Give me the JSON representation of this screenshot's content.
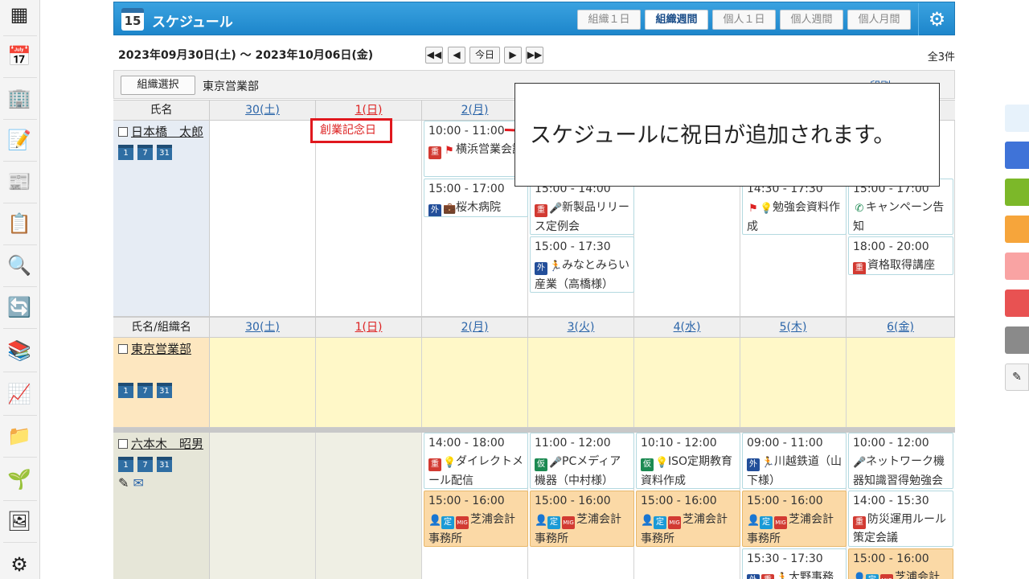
{
  "app": {
    "title": "スケジュール",
    "calendar_day": "15",
    "view_buttons": [
      "組織１日",
      "組織週間",
      "個人１日",
      "個人週間",
      "個人月間"
    ],
    "active_view": "組織週間"
  },
  "toolbar": {
    "date_range": "2023年09月30日(土) 〜 2023年10月06日(金)",
    "today": "今日",
    "count": "全3件",
    "org_select": "組織選択",
    "org_name": "東京営業部",
    "print": "印刷"
  },
  "headers": {
    "top": {
      "name": "氏名",
      "days": [
        "30(土)",
        "1(日)",
        "2(月)"
      ]
    },
    "second": {
      "name": "氏名/組織名",
      "days": [
        "30(土)",
        "1(日)",
        "2(月)",
        "3(火)",
        "4(水)",
        "5(木)",
        "6(金)"
      ]
    }
  },
  "holiday_label": "創業記念日",
  "callout_text": "スケジュールに祝日が追加されます。",
  "rows": {
    "user1": {
      "name": "日本橋　太郎",
      "events": {
        "e1": {
          "time": "10:00 - 11:00",
          "title": "横浜営業会議",
          "tag": "重"
        },
        "e2": {
          "time": "15:00 - 17:00",
          "title": "桜木病院",
          "tag": "外"
        },
        "e3": {
          "time": "15:00 - 14:00",
          "title": "新製品リリース定例会",
          "tag": "重"
        },
        "e4": {
          "time": "15:00 - 17:30",
          "title": "みなとみらい産業（高橋様）",
          "tag": "外"
        },
        "e5": {
          "time": "14:30 - 17:30",
          "title": "勉強会資料作成"
        },
        "e6": {
          "time": "15:00 - 17:00",
          "title": "キャンペーン告知"
        },
        "e7": {
          "time": "18:00 - 20:00",
          "title": "資格取得講座",
          "tag": "重"
        }
      }
    },
    "org": {
      "name": "東京営業部"
    },
    "user2": {
      "name": "六本木　昭男",
      "events": {
        "a1": {
          "time": "14:00 - 18:00",
          "title": "ダイレクトメール配信",
          "tag": "重"
        },
        "a2": {
          "time": "15:00 - 16:00",
          "title": "芝浦会計事務所",
          "tag": "定"
        },
        "b1": {
          "time": "11:00 - 12:00",
          "title": "PCメディア機器（中村様）",
          "tag": "仮"
        },
        "b2": {
          "time": "15:00 - 16:00",
          "title": "芝浦会計事務所",
          "tag": "定"
        },
        "c1": {
          "time": "10:10 - 12:00",
          "title": "ISO定期教育資料作成",
          "tag": "仮"
        },
        "c2": {
          "time": "15:00 - 16:00",
          "title": "芝浦会計事務所",
          "tag": "定"
        },
        "d1": {
          "time": "09:00 - 11:00",
          "title": "川越鉄道（山下様）",
          "tag": "外"
        },
        "d2": {
          "time": "15:00 - 16:00",
          "title": "芝浦会計事務所",
          "tag": "定"
        },
        "d3": {
          "time": "15:30 - 17:30",
          "title": "大野事務",
          "tag": "外"
        },
        "f1": {
          "time": "10:00 - 12:00",
          "title": "ネットワーク機器知識習得勉強会"
        },
        "f2": {
          "time": "14:00 - 15:30",
          "title": "防災運用ルール策定会議",
          "tag": "重"
        },
        "f3": {
          "time": "15:00 - 16:00",
          "title": "芝浦会計",
          "tag": "定"
        }
      }
    }
  },
  "tags": {
    "juu": "重",
    "gai": "外",
    "kari": "仮",
    "tei": "定",
    "mig": "MIG"
  },
  "colors": {
    "accent": "#1d86cb",
    "holiday_red": "#e0181e",
    "org_row": "#fff8c8",
    "name_col": "#e6ecf4"
  }
}
